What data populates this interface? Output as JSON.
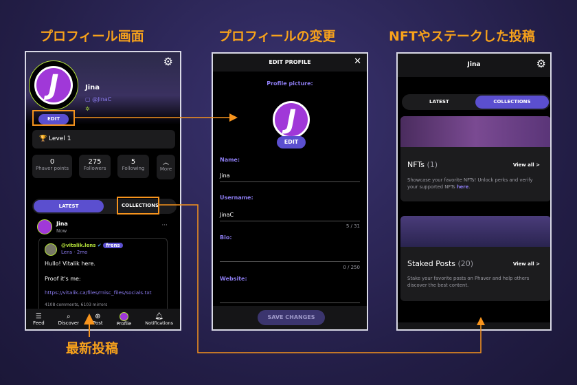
{
  "titles": {
    "profile": "プロフィール画面",
    "edit": "プロフィールの変更",
    "staked": "NFTやステークした投稿",
    "latest": "最新投稿"
  },
  "colors": {
    "accent": "#5b4fcf",
    "annotation": "#f7941d"
  },
  "profile": {
    "name": "Jina",
    "handle": "@JinaC",
    "edit": "EDIT",
    "level": "Level 1",
    "stats": [
      {
        "value": "0",
        "label": "Phaver points"
      },
      {
        "value": "275",
        "label": "Followers"
      },
      {
        "value": "5",
        "label": "Following"
      }
    ],
    "more": "More",
    "tabs": [
      "LATEST",
      "COLLECTIONS"
    ],
    "post": {
      "author": "Jina",
      "time": "Now",
      "quoted_handle": "@vitalik.lens",
      "badge": "frens",
      "source": "Lens · 2mo",
      "line1": "Hullo! Vitalik here.",
      "line2": "Proof it's me:",
      "link": "https://vitalik.ca/files/misc_files/socials.txt",
      "stats": "4108 comments, 6103 mirrors"
    },
    "nav": [
      "Feed",
      "Discover",
      "Post",
      "Profile",
      "Notifications"
    ]
  },
  "edit": {
    "title": "EDIT PROFILE",
    "picture_label": "Profile picture:",
    "edit": "EDIT",
    "name_label": "Name:",
    "name": "Jina",
    "username_label": "Username:",
    "username": "JinaC",
    "username_count": "5 / 31",
    "bio_label": "Bio:",
    "bio_count": "0 / 250",
    "website_label": "Website:",
    "save": "SAVE CHANGES"
  },
  "collections": {
    "title": "Jina",
    "tabs": [
      "LATEST",
      "COLLECTIONS"
    ],
    "nfts": {
      "title": "NFTs",
      "count": "(1)",
      "view": "View all >",
      "desc": "Showcase your favorite NFTs! Unlock perks and verify your supported NFTs ",
      "link": "here",
      "end": "."
    },
    "staked": {
      "title": "Staked Posts",
      "count": "(20)",
      "view": "View all >",
      "desc": "Stake your favorite posts on Phaver and help others discover the best content."
    }
  }
}
